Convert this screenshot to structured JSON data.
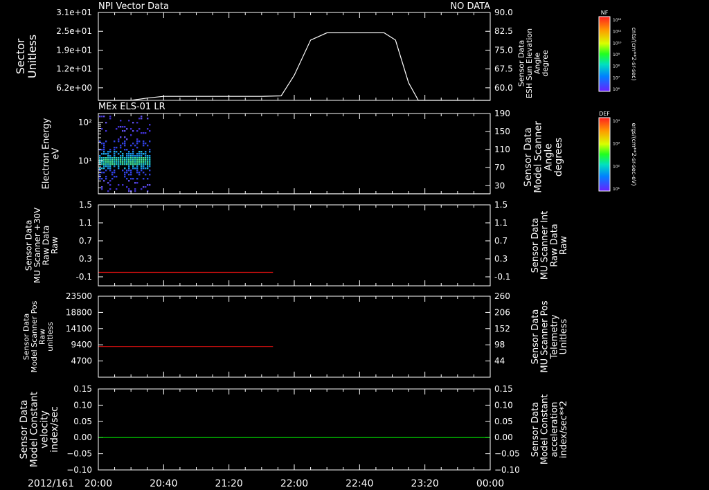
{
  "colors": {
    "background": "#000000",
    "foreground": "#ffffff",
    "red_trace": "#e01010",
    "green_trace": "#00e000",
    "right_label_red": "#ff2020",
    "right_label_green": "#00ff00"
  },
  "time_axis": {
    "date_label": "2012/161",
    "ticks": [
      "20:00",
      "20:40",
      "21:20",
      "22:00",
      "22:40",
      "23:20",
      "00:00"
    ],
    "range_minutes": [
      0,
      240
    ],
    "minor_step_minutes": 10
  },
  "colorbars": [
    {
      "title": "NF",
      "unit": "cnts/(cm**2-sr-sec)",
      "tick_labels": [
        "10¹²",
        "10¹¹",
        "10¹⁰",
        "10⁹",
        "10⁸",
        "10⁷",
        "10⁶"
      ]
    },
    {
      "title": "DEF",
      "unit": "ergs/(cm**2-sr-sec-eV)",
      "tick_labels": [
        "10⁴",
        "10³",
        "10²",
        "10¹"
      ]
    }
  ],
  "chart_data": [
    {
      "type": "line",
      "title": "NPI Vector Data",
      "status": "NO DATA",
      "left_label": [
        "Sector",
        "Unitless"
      ],
      "right_label": [
        "Sensor Data",
        "ESH Sun Elevation",
        "Angle",
        "degree"
      ],
      "left_ticks": [
        "3.1e+01",
        "2.5e+01",
        "1.9e+01",
        "1.2e+01",
        "6.2e+00"
      ],
      "right_ticks": [
        "90.0",
        "82.5",
        "75.0",
        "67.5",
        "60.0"
      ],
      "ylim": [
        55,
        90
      ],
      "right_tick_values": [
        90,
        82.5,
        75,
        67.5,
        60
      ],
      "series": [
        {
          "axis": "right",
          "color": "#ffffff",
          "x": [
            0,
            20,
            30,
            40,
            100,
            112,
            120,
            130,
            140,
            175,
            182,
            190,
            196,
            240
          ],
          "y": [
            55.0,
            55.0,
            55.9,
            56.6,
            56.6,
            56.8,
            65.0,
            79.0,
            81.9,
            81.9,
            79.0,
            62.0,
            55.0,
            55.0
          ]
        }
      ]
    },
    {
      "type": "heatmap",
      "title": "MEx ELS-01 LR",
      "left_label": [
        "Electron Energy",
        "eV"
      ],
      "right_label": [
        "Sensor Data",
        "Model Scanner",
        "Angle",
        "degrees"
      ],
      "left_ticks": [
        "10²",
        "10¹"
      ],
      "left_tick_values": [
        100,
        10
      ],
      "right_ticks": [
        "190",
        "150",
        "110",
        "70",
        "30"
      ],
      "ylim_log": [
        1.4,
        170
      ],
      "right_ylim": [
        12,
        190
      ],
      "right_tick_values": [
        190,
        150,
        110,
        70,
        30
      ],
      "data_extent_minutes": [
        0,
        32
      ],
      "band_center_eV": 11,
      "series": [
        {
          "axis": "right",
          "color": "#ffffff",
          "x": [
            0,
            240
          ],
          "y": [
            12,
            12
          ]
        }
      ]
    },
    {
      "type": "line",
      "left_label": [
        "Sensor Data",
        "MU Scanner +30V",
        "Raw Data",
        "Raw"
      ],
      "right_label": [
        "Sensor Data",
        "MU Scanner Int",
        "Raw Data",
        "Raw"
      ],
      "right_label_color": "#ff2020",
      "left_ticks": [
        "1.5",
        "1.1",
        "0.7",
        "0.3",
        "-0.1"
      ],
      "right_ticks": [
        "1.5",
        "1.1",
        "0.7",
        "0.3",
        "-0.1"
      ],
      "ylim": [
        -0.3,
        1.5
      ],
      "tick_values": [
        1.5,
        1.1,
        0.7,
        0.3,
        -0.1
      ],
      "series": [
        {
          "axis": "left",
          "color": "#e01010",
          "x": [
            0,
            107
          ],
          "y": [
            0.0,
            0.0
          ]
        }
      ]
    },
    {
      "type": "line",
      "left_label": [
        "Sensor Data",
        "Model Scanner Pos",
        "Raw",
        "unitless"
      ],
      "right_label": [
        "Sensor Data",
        "MU Scanner Pos",
        "Telemetry",
        "Unitless"
      ],
      "right_label_color": "#ff2020",
      "left_ticks": [
        "23500",
        "18800",
        "14100",
        "9400",
        "4700"
      ],
      "right_ticks": [
        "260",
        "206",
        "152",
        "98",
        "44"
      ],
      "ylim": [
        0,
        23500
      ],
      "left_tick_values": [
        23500,
        18800,
        14100,
        9400,
        4700
      ],
      "series": [
        {
          "axis": "left",
          "color": "#e01010",
          "x": [
            0,
            107
          ],
          "y": [
            8900,
            8900
          ]
        }
      ]
    },
    {
      "type": "line",
      "left_label": [
        "Sensor Data",
        "Model Constant",
        "velocity",
        "index/sec"
      ],
      "right_label": [
        "Sensor Data",
        "Model Constant",
        "acceleration",
        "index/sec**2"
      ],
      "right_label_color": "#00ff00",
      "left_ticks": [
        "0.15",
        "0.10",
        "0.05",
        "0.00",
        "−0.05",
        "−0.10"
      ],
      "right_ticks": [
        "0.15",
        "0.10",
        "0.05",
        "0.00",
        "−0.05",
        "−0.10"
      ],
      "ylim": [
        -0.1,
        0.15
      ],
      "tick_values": [
        0.15,
        0.1,
        0.05,
        0.0,
        -0.05,
        -0.1
      ],
      "series": [
        {
          "axis": "left",
          "color": "#00e000",
          "x": [
            0,
            240
          ],
          "y": [
            0.0,
            0.0
          ]
        }
      ]
    }
  ]
}
